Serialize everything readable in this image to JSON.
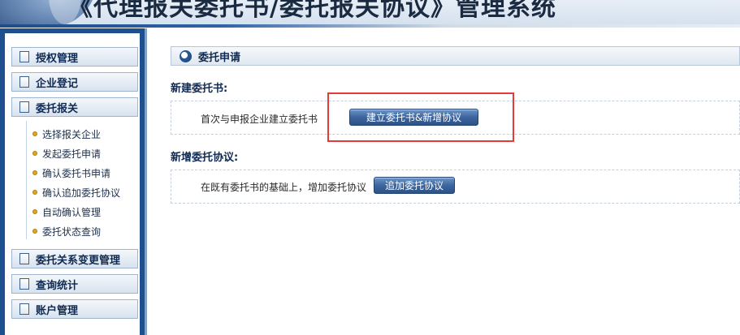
{
  "app": {
    "title": "《代理报关委托书/委托报关协议》管理系统"
  },
  "sidebar": {
    "menus": [
      {
        "label": "授权管理"
      },
      {
        "label": "企业登记"
      },
      {
        "label": "委托报关"
      },
      {
        "label": "委托关系变更管理"
      },
      {
        "label": "查询统计"
      },
      {
        "label": "账户管理"
      }
    ],
    "sub_items": [
      {
        "label": "选择报关企业"
      },
      {
        "label": "发起委托申请"
      },
      {
        "label": "确认委托书申请"
      },
      {
        "label": "确认追加委托协议"
      },
      {
        "label": "自动确认管理"
      },
      {
        "label": "委托状态查询"
      }
    ]
  },
  "main": {
    "panel_title": "委托申请",
    "section1": {
      "title": "新建委托书:",
      "description": "首次与申报企业建立委托书",
      "button_label": "建立委托书&新增协议"
    },
    "section2": {
      "title": "新增委托协议:",
      "description": "在既有委托书的基础上，增加委托协议",
      "button_label": "追加委托协议"
    }
  },
  "colors": {
    "sidebar_bg": "#1e4f8f",
    "highlight": "#e53a3a",
    "button": "#3d669e",
    "bullet": "#e0a820"
  },
  "icons": {
    "menu": "folder-box-icon",
    "bullet": "bullet-dot-icon",
    "panel": "circle-arrow-icon"
  }
}
